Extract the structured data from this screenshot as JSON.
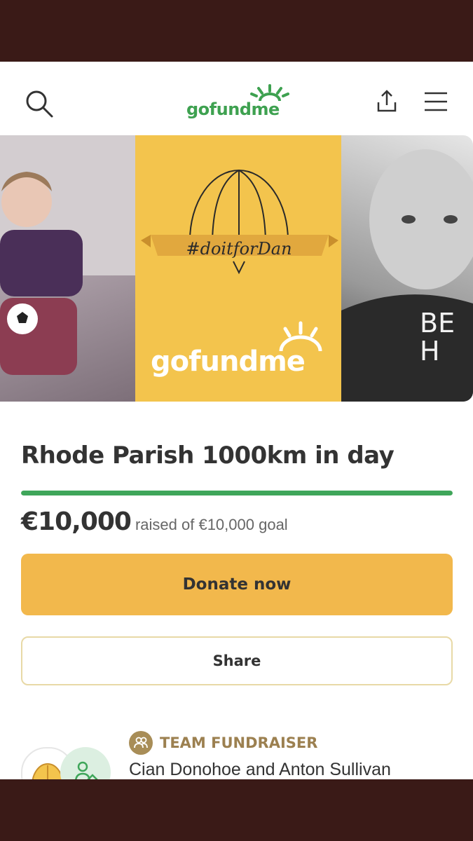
{
  "header": {
    "brand": "gofundme",
    "icons": [
      "search-icon",
      "share-icon",
      "menu-icon"
    ]
  },
  "hero": {
    "hashtag": "#doitforDan",
    "brand": "gofundme",
    "shirt_text": "BE H"
  },
  "campaign": {
    "title": "Rhode Parish 1000km in day",
    "amount_raised": "€10,000",
    "goal_text": "raised of €10,000 goal",
    "progress_fraction": 1.0
  },
  "actions": {
    "donate_label": "Donate now",
    "share_label": "Share"
  },
  "team": {
    "label": "TEAM FUNDRAISER",
    "organizers": "Cian Donohoe and Anton Sullivan"
  },
  "colors": {
    "brand_green": "#3ea150",
    "donate_button": "#f2b84c",
    "progress_green": "#3fa65a",
    "team_label": "#9c8050"
  }
}
